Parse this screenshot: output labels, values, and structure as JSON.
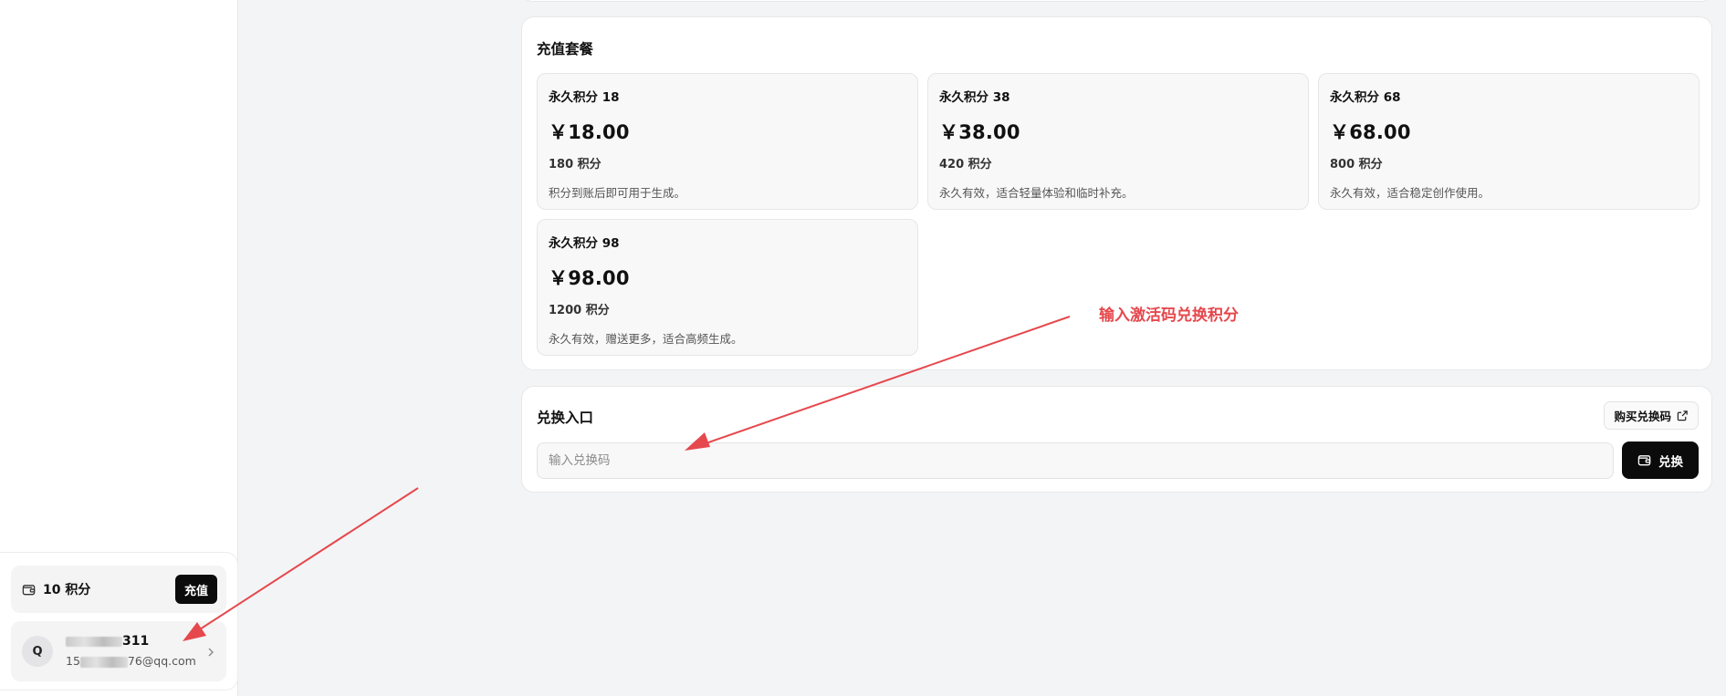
{
  "sidebar": {
    "credits_label": "10 积分",
    "recharge_label": "充值",
    "user": {
      "avatar_letter": "Q",
      "name_suffix": "311",
      "email_prefix": "15",
      "email_suffix": "76@qq.com"
    }
  },
  "plans": {
    "title": "充值套餐",
    "items": [
      {
        "name": "永久积分 18",
        "price": "￥18.00",
        "points": "180 积分",
        "desc": "积分到账后即可用于生成。"
      },
      {
        "name": "永久积分 38",
        "price": "￥38.00",
        "points": "420 积分",
        "desc": "永久有效，适合轻量体验和临时补充。"
      },
      {
        "name": "永久积分 68",
        "price": "￥68.00",
        "points": "800 积分",
        "desc": "永久有效，适合稳定创作使用。"
      },
      {
        "name": "永久积分 98",
        "price": "￥98.00",
        "points": "1200 积分",
        "desc": "永久有效，赠送更多，适合高频生成。"
      }
    ]
  },
  "redeem": {
    "title": "兑换入口",
    "buy_code_label": "购买兑换码",
    "input_placeholder": "输入兑换码",
    "input_value": "",
    "redeem_label": "兑换"
  },
  "annotation": {
    "text": "输入激活码兑换积分",
    "color": "#e5484d"
  },
  "icons": {
    "wallet": "wallet-icon",
    "external": "external-link-icon",
    "chevron": "chevron-right-icon"
  }
}
